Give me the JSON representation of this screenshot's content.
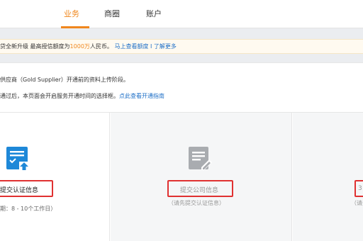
{
  "nav": {
    "tabs": [
      {
        "label": "业务",
        "active": true
      },
      {
        "label": "商圈",
        "active": false
      },
      {
        "label": "账户",
        "active": false
      }
    ]
  },
  "notice": {
    "text_before": "贷全新升级 最高授信额度为",
    "highlight": "1000万",
    "text_after": "人民币。",
    "link1": "马上查看额度",
    "separator": "I",
    "link2": "了解更多"
  },
  "description": {
    "line1": "供应商（Gold Supplier）开通前的资料上传阶段。",
    "line2_text": "通过后，本页面会开启服务开通时间的选择框。",
    "line2_link": "点此查看开通指南"
  },
  "steps": [
    {
      "title": "提交认证信息",
      "subtitle": "期：8 - 10个工作日）",
      "icon": "certificate-upload-icon",
      "state": "active"
    },
    {
      "title": "提交公司信息",
      "subtitle": "（请先提交认证信息）",
      "icon": "document-edit-icon",
      "state": "disabled"
    },
    {
      "title": "3",
      "subtitle": "（请先",
      "icon": "",
      "state": "disabled"
    }
  ],
  "colors": {
    "accent": "#f0871d",
    "link": "#1e6fc7",
    "icon_active": "#1e88d8",
    "icon_disabled": "#a9acb0",
    "highlight_frame": "#e03131"
  }
}
